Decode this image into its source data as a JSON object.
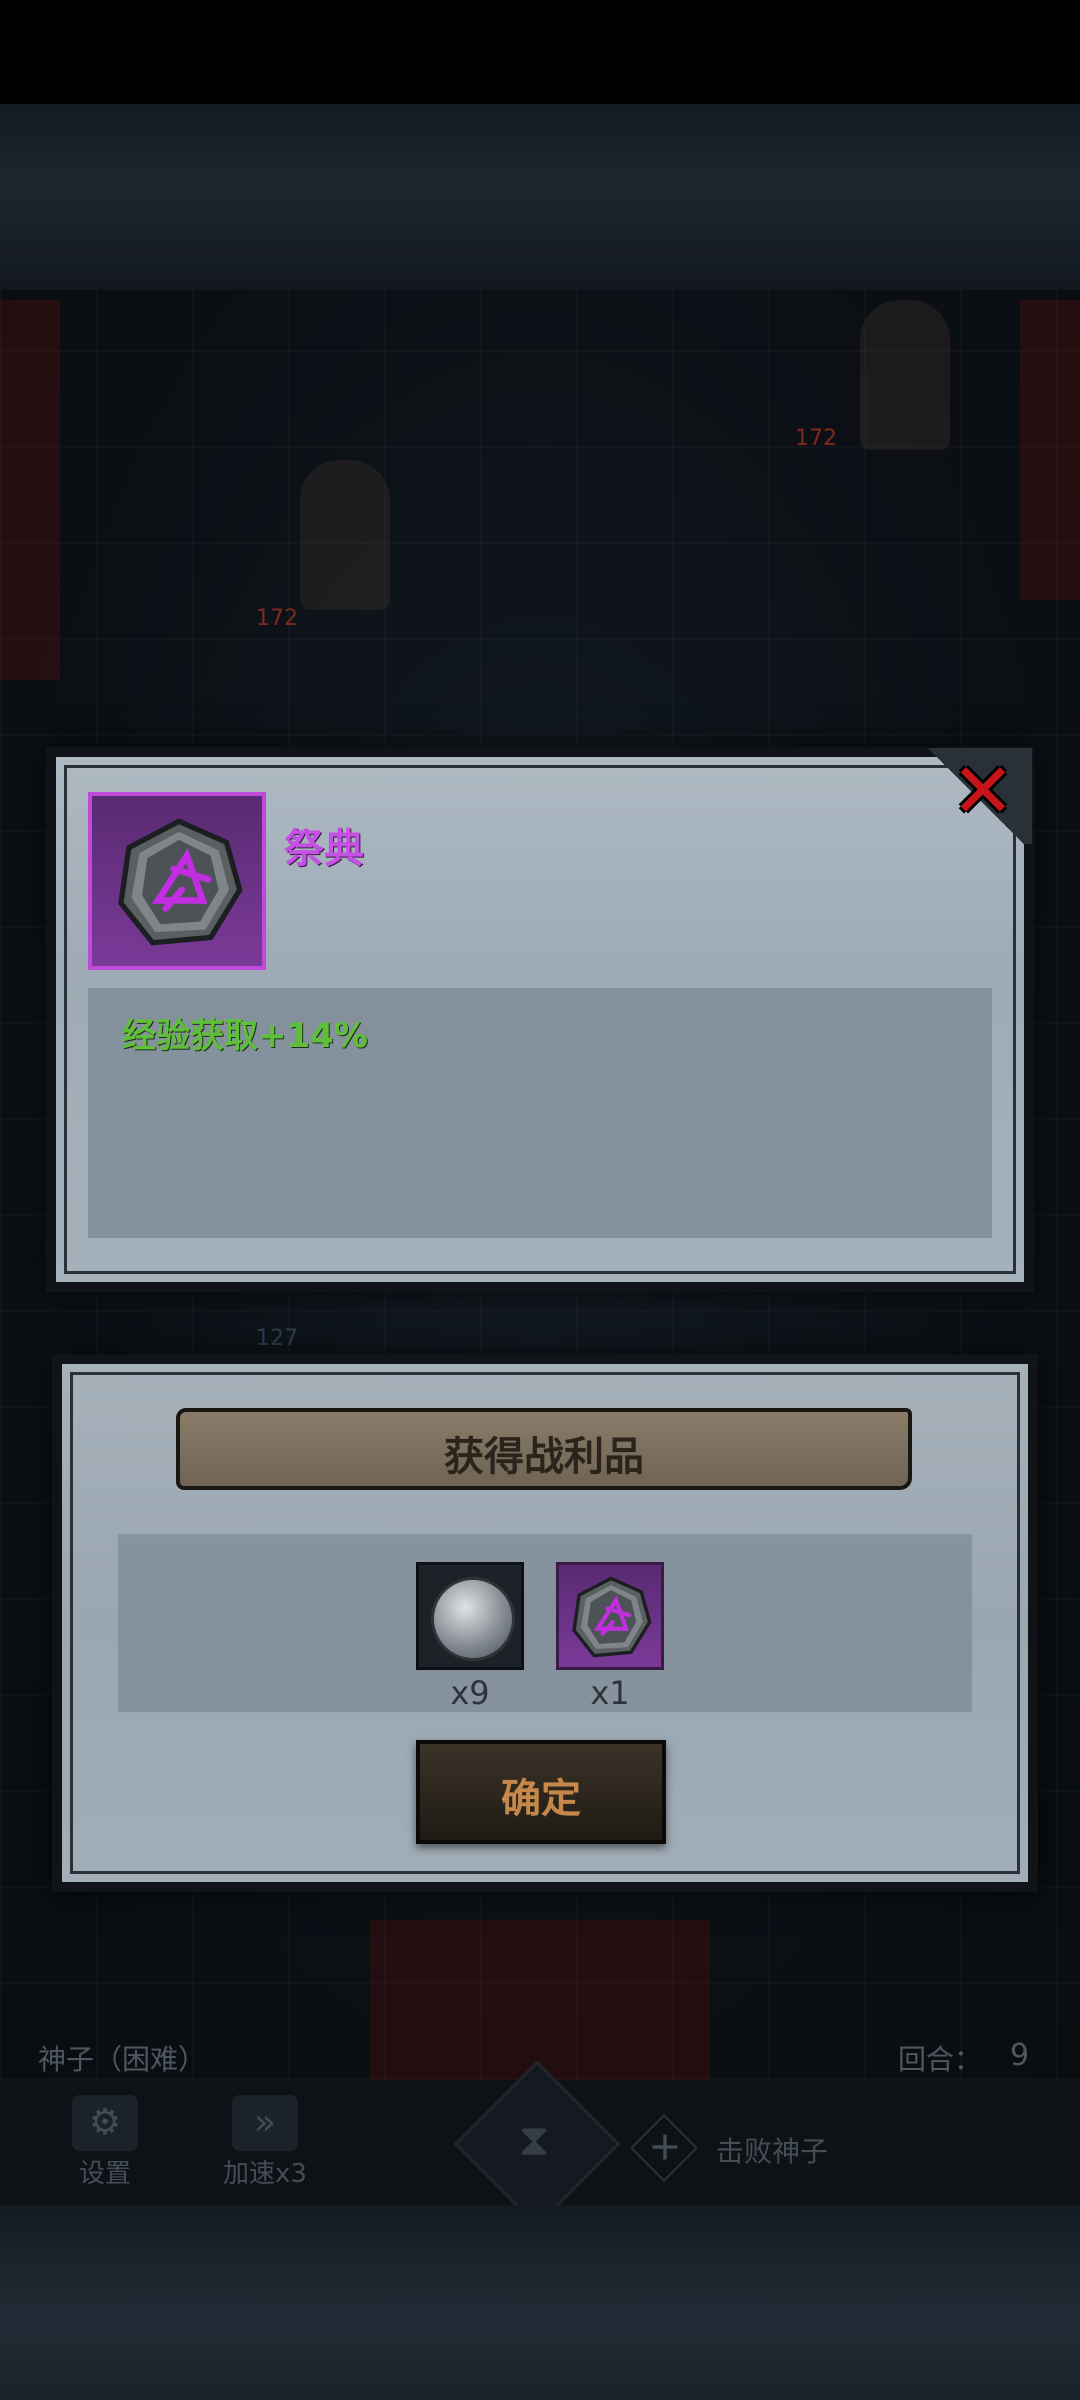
{
  "background": {
    "hp_numbers": [
      "172",
      "172",
      "127"
    ],
    "hud": {
      "stage_label": "神子（困难）",
      "round_label": "回合：",
      "round_value": "9"
    },
    "bottom_bar": {
      "settings_label": "设置",
      "speed_label": "加速x3",
      "defeat_label": "击败神子"
    }
  },
  "item_detail": {
    "name": "祭典",
    "effect": "经验获取+14%",
    "rarity_color": "#c04ad8"
  },
  "loot_panel": {
    "title": "获得战利品",
    "items": [
      {
        "icon": "silver-coin-icon",
        "count": "x9"
      },
      {
        "icon": "rune-stone-icon",
        "count": "x1"
      }
    ],
    "confirm_label": "确定"
  }
}
